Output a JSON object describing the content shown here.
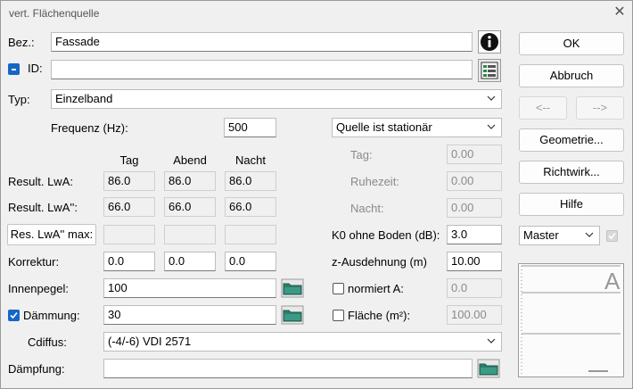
{
  "window": {
    "title": "vert. Flächenquelle"
  },
  "form": {
    "bez_label": "Bez.:",
    "bez_value": "Fassade",
    "id_label": "ID:",
    "id_value": "",
    "typ_label": "Typ:",
    "typ_value": "Einzelband",
    "freq_label": "Frequenz (Hz):",
    "freq_value": "500",
    "quelle_value": "Quelle ist stationär",
    "col_tag": "Tag",
    "col_abend": "Abend",
    "col_nacht": "Nacht",
    "lwa_label": "Result. LwA:",
    "lwa_values": [
      "86.0",
      "86.0",
      "86.0"
    ],
    "lwa2_label": "Result. LwA'':",
    "lwa2_values": [
      "66.0",
      "66.0",
      "66.0"
    ],
    "res_button": "Res. LwA'' max:",
    "res_values": [
      "",
      "",
      ""
    ],
    "korr_label": "Korrektur:",
    "korr_values": [
      "0.0",
      "0.0",
      "0.0"
    ],
    "innen_label": "Innenpegel:",
    "innen_value": "100",
    "daemm_label": "Dämmung:",
    "daemm_value": "30",
    "cdiffus_label": "Cdiffus:",
    "cdiffus_value": "(-4/-6) VDI 2571",
    "daempf_label": "Dämpfung:",
    "daempf_value": ""
  },
  "right_fields": {
    "tag_label": "Tag:",
    "tag_value": "0.00",
    "ruhe_label": "Ruhezeit:",
    "ruhe_value": "0.00",
    "nacht_label": "Nacht:",
    "nacht_value": "0.00",
    "k0_label": "K0 ohne Boden (dB):",
    "k0_value": "3.0",
    "z_label": "z-Ausdehnung (m)",
    "z_value": "10.00",
    "normiert_label": "normiert A:",
    "normiert_value": "0.0",
    "flaeche_label": "Fläche (m²):",
    "flaeche_value": "100.00"
  },
  "buttons": {
    "ok": "OK",
    "abbruch": "Abbruch",
    "prev": "<--",
    "next": "-->",
    "geometrie": "Geometrie...",
    "richtwirk": "Richtwirk...",
    "hilfe": "Hilfe",
    "master": "Master"
  },
  "preview": {
    "letter": "A"
  }
}
